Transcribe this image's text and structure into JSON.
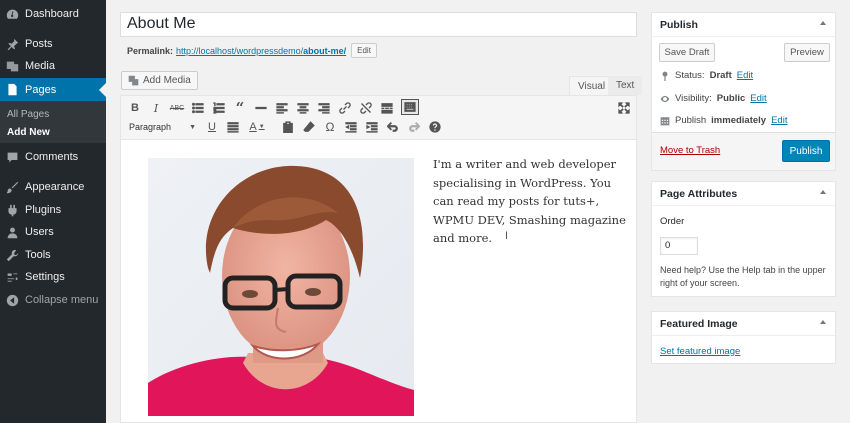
{
  "sidebar": {
    "items": [
      {
        "label": "Dashboard",
        "icon": "dashboard-icon"
      },
      {
        "label": "Posts",
        "icon": "pushpin-icon"
      },
      {
        "label": "Media",
        "icon": "media-icon"
      },
      {
        "label": "Pages",
        "icon": "pages-icon"
      },
      {
        "label": "Comments",
        "icon": "comments-icon"
      },
      {
        "label": "Appearance",
        "icon": "brush-icon"
      },
      {
        "label": "Plugins",
        "icon": "plugin-icon"
      },
      {
        "label": "Users",
        "icon": "users-icon"
      },
      {
        "label": "Tools",
        "icon": "wrench-icon"
      },
      {
        "label": "Settings",
        "icon": "settings-icon"
      },
      {
        "label": "Collapse menu",
        "icon": "collapse-icon"
      }
    ],
    "submenu": [
      "All Pages",
      "Add New"
    ],
    "current": "Pages"
  },
  "editor": {
    "title": "About Me",
    "permalink_label": "Permalink:",
    "permalink_base": "http://localhost/wordpressdemo/",
    "permalink_slug": "about-me/",
    "permalink_edit": "Edit",
    "add_media": "Add Media",
    "tab_visual": "Visual",
    "tab_text": "Text",
    "format": "Paragraph",
    "body": "I'm a writer and web developer specialising in WordPress. You can read my posts for tuts+, WPMU DEV, Smashing magazine and more.",
    "cursor": "I"
  },
  "publish": {
    "heading": "Publish",
    "save_draft": "Save Draft",
    "preview": "Preview",
    "status_label": "Status:",
    "status_value": "Draft",
    "visibility_label": "Visibility:",
    "visibility_value": "Public",
    "publish_label": "Publish",
    "publish_value": "immediately",
    "edit": "Edit",
    "trash": "Move to Trash",
    "publish_button": "Publish"
  },
  "attributes": {
    "heading": "Page Attributes",
    "order_label": "Order",
    "order_value": "0",
    "help": "Need help? Use the Help tab in the upper right of your screen."
  },
  "featured": {
    "heading": "Featured Image",
    "link": "Set featured image"
  },
  "colors": {
    "admin_bar": "#23282d",
    "accent": "#0073aa",
    "publish": "#0085ba",
    "shirt": "#e0155a"
  }
}
